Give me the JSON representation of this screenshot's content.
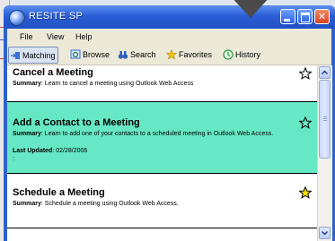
{
  "window": {
    "title": "RESITE SP",
    "buttons": {
      "minimize": "minimize-icon",
      "maximize": "maximize-icon",
      "close": "close-icon"
    }
  },
  "menu": [
    "File",
    "View",
    "Help"
  ],
  "toolbar": {
    "items": [
      {
        "label": "Matching",
        "icon": "matching-icon"
      },
      {
        "label": "Browse",
        "icon": "browse-icon"
      },
      {
        "label": "Search",
        "icon": "binoculars-icon"
      },
      {
        "label": "Favorites",
        "icon": "star-icon"
      },
      {
        "label": "History",
        "icon": "history-icon"
      }
    ],
    "active": "Matching"
  },
  "entries": [
    {
      "title": "Cancel a Meeting",
      "summary_label": "Summary",
      "summary": ": Learn to cancel a meeting using Outlook Web Access",
      "favorite": false
    },
    {
      "title": "Add a Contact to a Meeting",
      "summary_label": "Summary",
      "summary": ": Learn to add one of your contacts to a scheduled meeting in Outlook Web Access.",
      "updated_label": "Last Updated",
      "updated": ": 02/28/2006",
      "extra": ":",
      "favorite": false,
      "highlighted": true
    },
    {
      "title": "Schedule a Meeting",
      "summary_label": "Summary",
      "summary": ": Schedule a meeting using Outlook Web Access.",
      "favorite": true
    }
  ],
  "colors": {
    "titlebar": "#2a5ed6",
    "highlight": "#66e8c5",
    "favorite_star": "#f0e000"
  }
}
